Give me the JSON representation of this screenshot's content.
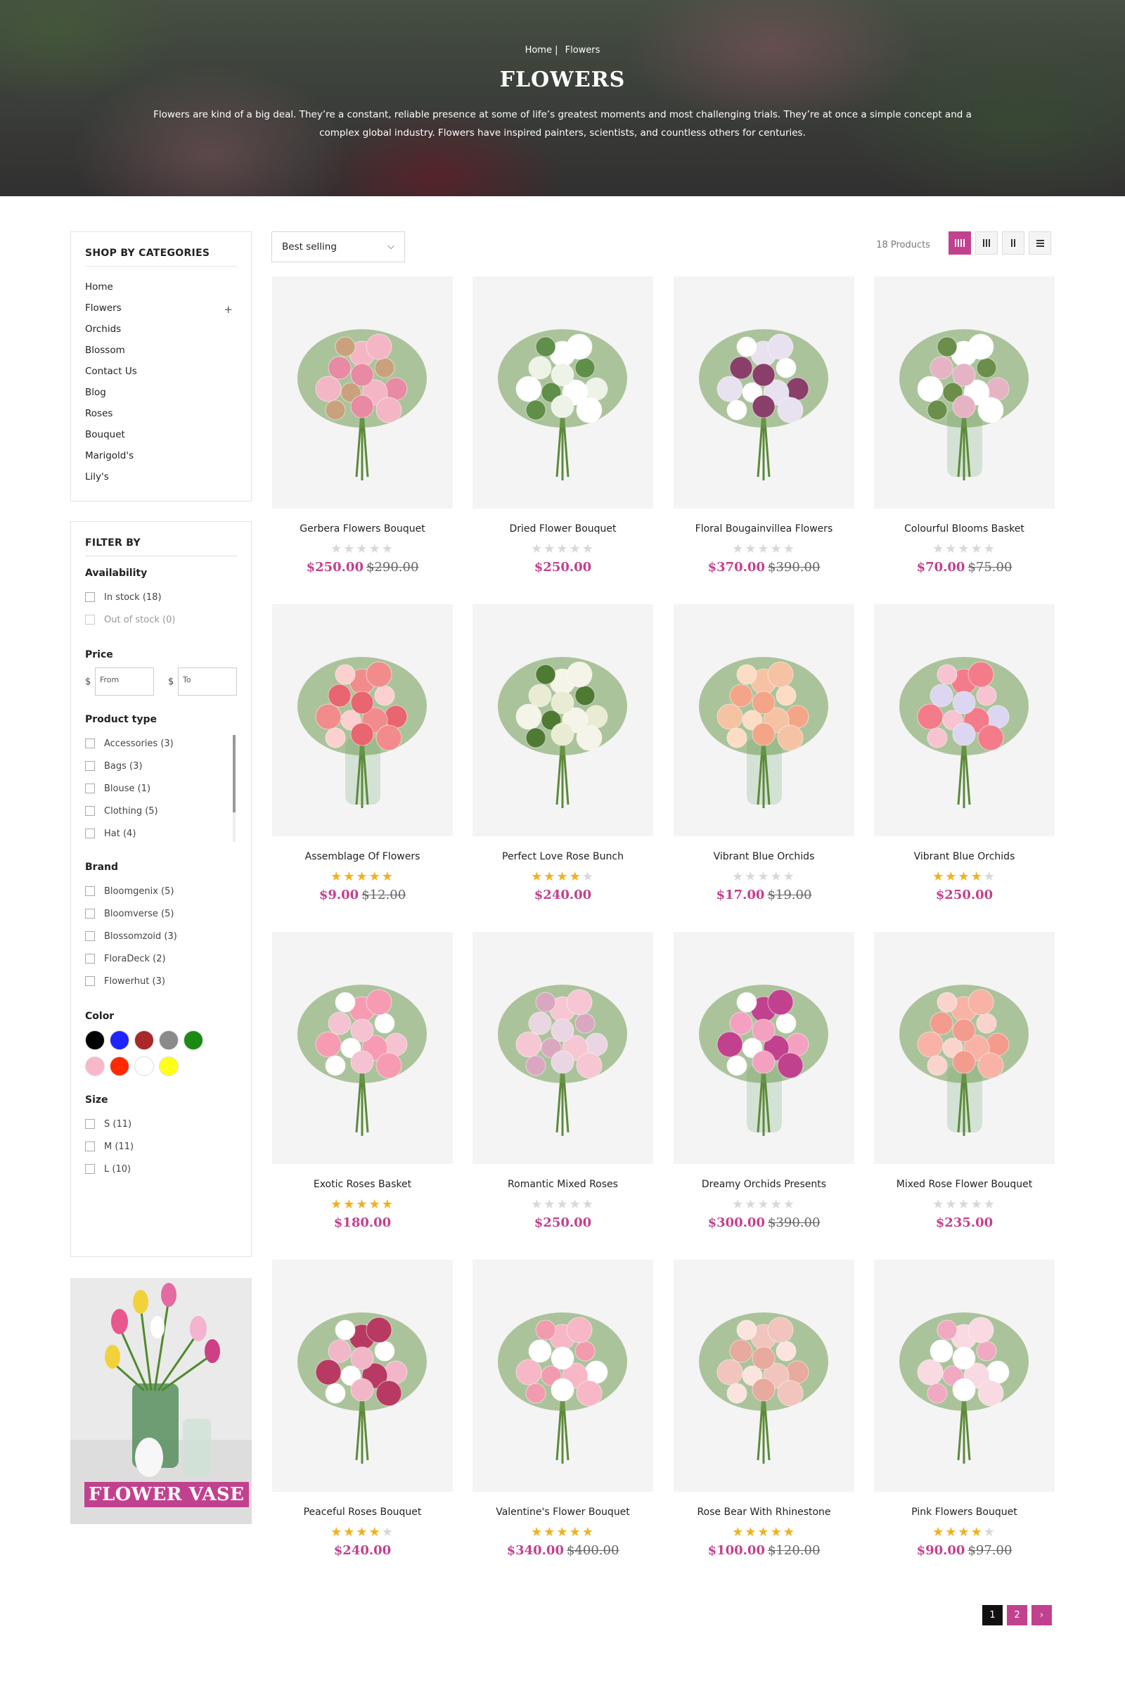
{
  "hero": {
    "breadcrumb": [
      "Home |",
      "Flowers"
    ],
    "title": "FLOWERS",
    "description": "Flowers are kind of a big deal. They’re a constant, reliable presence at some of life’s greatest moments and most challenging trials. They’re at once a simple concept and a complex global industry. Flowers have inspired painters, scientists, and countless others for centuries."
  },
  "categories": {
    "title": "SHOP BY CATEGORIES",
    "items": [
      "Home",
      "Flowers",
      "Orchids",
      "Blossom",
      "Contact Us",
      "Blog",
      "Roses",
      "Bouquet",
      "Marigold's",
      "Lily's"
    ],
    "expand_symbol": "+"
  },
  "filter": {
    "title": "FILTER BY",
    "availability": {
      "title": "Availability",
      "options": [
        "In stock (18)",
        "Out of stock (0)"
      ]
    },
    "price": {
      "title": "Price",
      "currency": "$",
      "from_placeholder": "From",
      "to_placeholder": "To"
    },
    "product_type": {
      "title": "Product type",
      "options": [
        "Accessories (3)",
        "Bags (3)",
        "Blouse (1)",
        "Clothing (5)",
        "Hat (4)"
      ]
    },
    "brand": {
      "title": "Brand",
      "options": [
        "Bloomgenix (5)",
        "Bloomverse (5)",
        "Blossomzoid (3)",
        "FloraDeck (2)",
        "Flowerhut (3)"
      ]
    },
    "color": {
      "title": "Color",
      "swatches": [
        "#000000",
        "#1f24ff",
        "#a8282b",
        "#8a8a8a",
        "#1b8a13",
        "#f9b8c8",
        "#ff2a00",
        "#ffffff",
        "#ffff1a"
      ]
    },
    "size": {
      "title": "Size",
      "options": [
        "S (11)",
        "M (11)",
        "L (10)"
      ]
    }
  },
  "promo": {
    "label": "FLOWER VASE"
  },
  "toolbar": {
    "sort_label": "Best selling",
    "sort_arrow": "⌵",
    "product_count": "18 Products"
  },
  "colors": {
    "accent": "#c2418f",
    "star": "#f2b01e"
  },
  "products": [
    {
      "name": "Gerbera Flowers Bouquet",
      "rating": 0,
      "price": "$250.00",
      "old_price": "$290.00"
    },
    {
      "name": "Dried Flower Bouquet",
      "rating": 0,
      "price": "$250.00",
      "old_price": ""
    },
    {
      "name": "Floral Bougainvillea Flowers",
      "rating": 0,
      "price": "$370.00",
      "old_price": "$390.00"
    },
    {
      "name": "Colourful Blooms Basket",
      "rating": 0,
      "price": "$70.00",
      "old_price": "$75.00"
    },
    {
      "name": "Assemblage Of Flowers",
      "rating": 5,
      "price": "$9.00",
      "old_price": "$12.00"
    },
    {
      "name": "Perfect Love Rose Bunch",
      "rating": 4,
      "price": "$240.00",
      "old_price": ""
    },
    {
      "name": "Vibrant Blue Orchids",
      "rating": 0,
      "price": "$17.00",
      "old_price": "$19.00"
    },
    {
      "name": "Vibrant Blue Orchids",
      "rating": 4,
      "price": "$250.00",
      "old_price": ""
    },
    {
      "name": "Exotic Roses Basket",
      "rating": 5,
      "price": "$180.00",
      "old_price": ""
    },
    {
      "name": "Romantic Mixed Roses",
      "rating": 0,
      "price": "$250.00",
      "old_price": ""
    },
    {
      "name": "Dreamy Orchids Presents",
      "rating": 0,
      "price": "$300.00",
      "old_price": "$390.00"
    },
    {
      "name": "Mixed Rose Flower Bouquet",
      "rating": 0,
      "price": "$235.00",
      "old_price": ""
    },
    {
      "name": "Peaceful Roses Bouquet",
      "rating": 4,
      "price": "$240.00",
      "old_price": ""
    },
    {
      "name": "Valentine's Flower Bouquet",
      "rating": 5,
      "price": "$340.00",
      "old_price": "$400.00"
    },
    {
      "name": "Rose Bear With Rhinestone",
      "rating": 5,
      "price": "$100.00",
      "old_price": "$120.00"
    },
    {
      "name": "Pink Flowers Bouquet",
      "rating": 4,
      "price": "$90.00",
      "old_price": "$97.00"
    }
  ],
  "pagination": {
    "pages": [
      "1",
      "2"
    ],
    "next_symbol": "›"
  }
}
